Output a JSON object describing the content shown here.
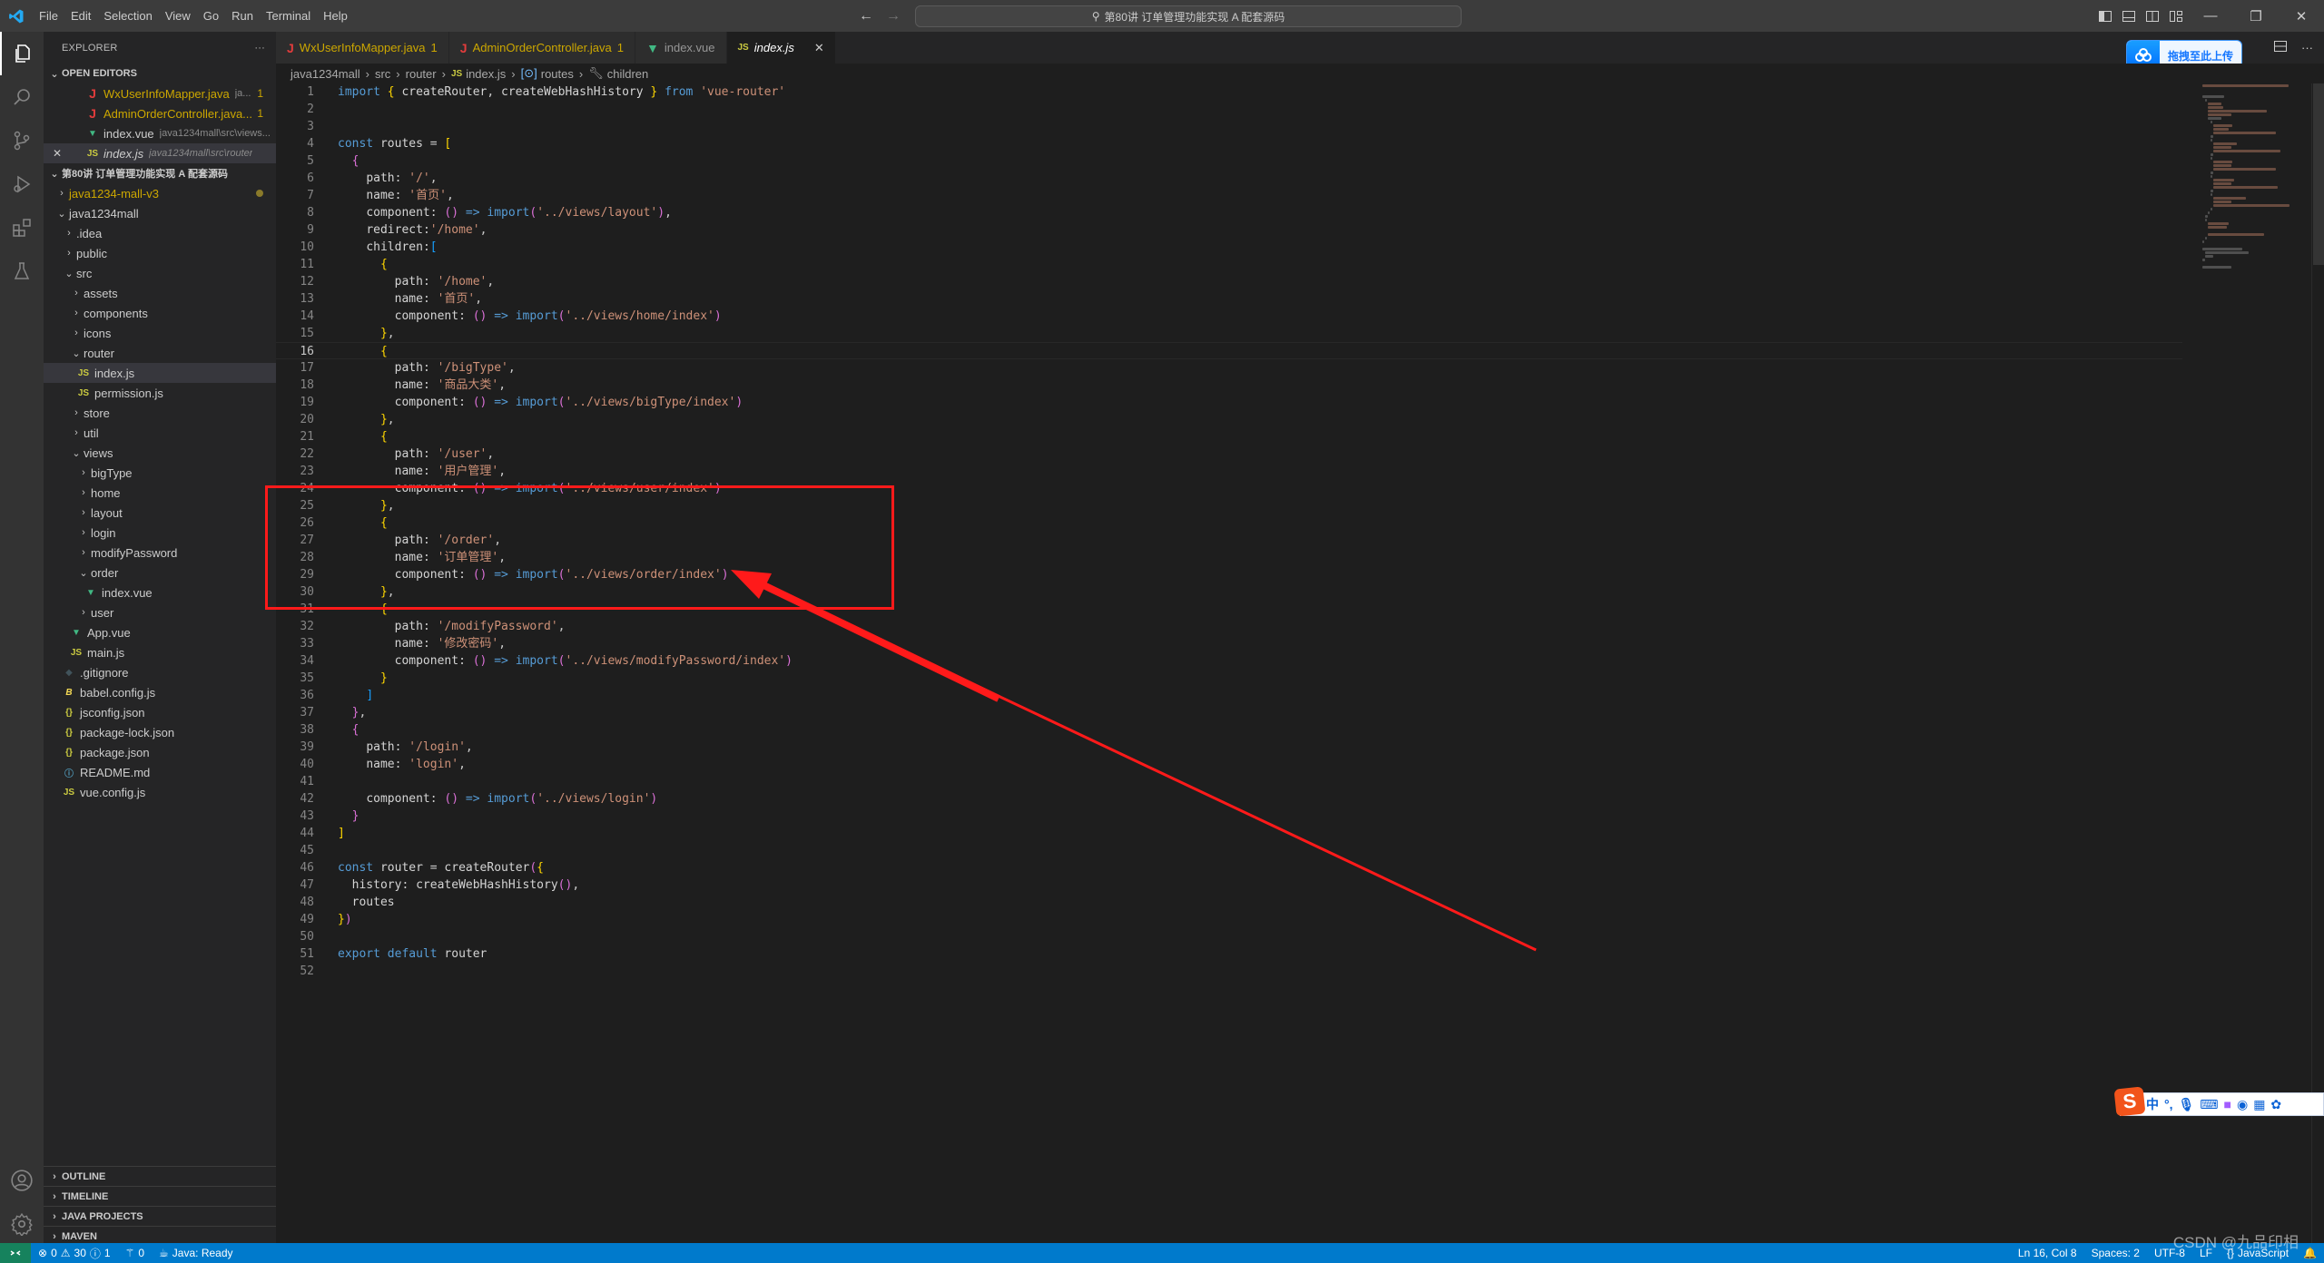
{
  "titlebar": {
    "menu": [
      "File",
      "Edit",
      "Selection",
      "View",
      "Go",
      "Run",
      "Terminal",
      "Help"
    ],
    "command_center": "第80讲 订单管理功能实现 A 配套源码"
  },
  "explorer": {
    "title": "EXPLORER",
    "more": "···",
    "open_editors_label": "OPEN EDITORS",
    "open_editors": [
      {
        "name": "WxUserInfoMapper.java",
        "desc": "ja...",
        "badge": "1",
        "icon": "J",
        "type": "java"
      },
      {
        "name": "AdminOrderController.java...",
        "desc": "",
        "badge": "1",
        "icon": "J",
        "type": "java"
      },
      {
        "name": "index.vue",
        "desc": "java1234mall\\src\\views...",
        "badge": "",
        "icon": "V",
        "type": "vue"
      },
      {
        "name": "index.js",
        "desc": "java1234mall\\src\\router",
        "badge": "",
        "icon": "JS",
        "type": "js"
      }
    ],
    "workspace_label": "第80讲 订单管理功能实现 A 配套源码",
    "tree": [
      {
        "name": "java1234-mall-v3",
        "depth": 1,
        "kind": "folder",
        "open": false,
        "modified": true
      },
      {
        "name": "java1234mall",
        "depth": 1,
        "kind": "folder",
        "open": true
      },
      {
        "name": ".idea",
        "depth": 2,
        "kind": "folder",
        "open": false
      },
      {
        "name": "public",
        "depth": 2,
        "kind": "folder",
        "open": false
      },
      {
        "name": "src",
        "depth": 2,
        "kind": "folder",
        "open": true
      },
      {
        "name": "assets",
        "depth": 3,
        "kind": "folder",
        "open": false
      },
      {
        "name": "components",
        "depth": 3,
        "kind": "folder",
        "open": false
      },
      {
        "name": "icons",
        "depth": 3,
        "kind": "folder",
        "open": false
      },
      {
        "name": "router",
        "depth": 3,
        "kind": "folder",
        "open": true
      },
      {
        "name": "index.js",
        "depth": 4,
        "kind": "js",
        "selected": true
      },
      {
        "name": "permission.js",
        "depth": 4,
        "kind": "js"
      },
      {
        "name": "store",
        "depth": 3,
        "kind": "folder",
        "open": false
      },
      {
        "name": "util",
        "depth": 3,
        "kind": "folder",
        "open": false
      },
      {
        "name": "views",
        "depth": 3,
        "kind": "folder",
        "open": true
      },
      {
        "name": "bigType",
        "depth": 4,
        "kind": "folder",
        "open": false
      },
      {
        "name": "home",
        "depth": 4,
        "kind": "folder",
        "open": false
      },
      {
        "name": "layout",
        "depth": 4,
        "kind": "folder",
        "open": false
      },
      {
        "name": "login",
        "depth": 4,
        "kind": "folder",
        "open": false
      },
      {
        "name": "modifyPassword",
        "depth": 4,
        "kind": "folder",
        "open": false
      },
      {
        "name": "order",
        "depth": 4,
        "kind": "folder",
        "open": true
      },
      {
        "name": "index.vue",
        "depth": 5,
        "kind": "vue"
      },
      {
        "name": "user",
        "depth": 4,
        "kind": "folder",
        "open": false
      },
      {
        "name": "App.vue",
        "depth": 3,
        "kind": "vue"
      },
      {
        "name": "main.js",
        "depth": 3,
        "kind": "js"
      },
      {
        "name": ".gitignore",
        "depth": 2,
        "kind": "git"
      },
      {
        "name": "babel.config.js",
        "depth": 2,
        "kind": "babel"
      },
      {
        "name": "jsconfig.json",
        "depth": 2,
        "kind": "json"
      },
      {
        "name": "package-lock.json",
        "depth": 2,
        "kind": "json"
      },
      {
        "name": "package.json",
        "depth": 2,
        "kind": "json"
      },
      {
        "name": "README.md",
        "depth": 2,
        "kind": "info"
      },
      {
        "name": "vue.config.js",
        "depth": 2,
        "kind": "js"
      }
    ],
    "bottom_sections": [
      "OUTLINE",
      "TIMELINE",
      "JAVA PROJECTS",
      "MAVEN"
    ]
  },
  "tabs": [
    {
      "label": "WxUserInfoMapper.java",
      "badge": "1",
      "icon": "J",
      "type": "java",
      "active": false
    },
    {
      "label": "AdminOrderController.java",
      "badge": "1",
      "icon": "J",
      "type": "java",
      "active": false
    },
    {
      "label": "index.vue",
      "badge": "",
      "icon": "V",
      "type": "vue",
      "active": false
    },
    {
      "label": "index.js",
      "badge": "",
      "icon": "JS",
      "type": "js",
      "active": true
    }
  ],
  "upload_button": "拖拽至此上传",
  "breadcrumb": [
    "java1234mall",
    "src",
    "router",
    "index.js",
    "routes",
    "children"
  ],
  "editor": {
    "current_line": 16,
    "lines": [
      "import { createRouter, createWebHashHistory } from 'vue-router'",
      "",
      "",
      "const routes = [",
      "  {",
      "    path: '/',",
      "    name: '首页',",
      "    component: () => import('../views/layout'),",
      "    redirect:'/home',",
      "    children:[",
      "      {",
      "        path: '/home',",
      "        name: '首页',",
      "        component: () => import('../views/home/index')",
      "      },",
      "      {",
      "        path: '/bigType',",
      "        name: '商品大类',",
      "        component: () => import('../views/bigType/index')",
      "      },",
      "      {",
      "        path: '/user',",
      "        name: '用户管理',",
      "        component: () => import('../views/user/index')",
      "      },",
      "      {",
      "        path: '/order',",
      "        name: '订单管理',",
      "        component: () => import('../views/order/index')",
      "      },",
      "      {",
      "        path: '/modifyPassword',",
      "        name: '修改密码',",
      "        component: () => import('../views/modifyPassword/index')",
      "      }",
      "    ]",
      "  },",
      "  {",
      "    path: '/login',",
      "    name: 'login',",
      "",
      "    component: () => import('../views/login')",
      "  }",
      "]",
      "",
      "const router = createRouter({",
      "  history: createWebHashHistory(),",
      "  routes",
      "})",
      "",
      "export default router",
      ""
    ]
  },
  "ime_toolbar": [
    "中",
    "°,",
    "mic",
    "keyboard",
    "skin",
    "bot",
    "apps",
    "settings"
  ],
  "statusbar": {
    "errors": "0",
    "warnings": "30",
    "infos": "1",
    "ports": "0",
    "java_status": "Java: Ready",
    "position": "Ln 16, Col 8",
    "indent": "Spaces: 2",
    "encoding": "UTF-8",
    "eol": "LF",
    "language": "JavaScript"
  },
  "watermark": "CSDN @九品印相",
  "colors": {
    "accent": "#007acc",
    "annotation": "#ff1a1a",
    "remote": "#16825d"
  }
}
